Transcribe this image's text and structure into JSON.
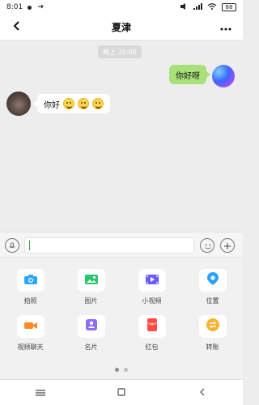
{
  "status_bar": {
    "time": "8:01",
    "battery": "88"
  },
  "header": {
    "title": "夏津"
  },
  "chat": {
    "time_badge": "晚上 20:00",
    "messages": [
      {
        "side": "right",
        "text": "你好呀"
      },
      {
        "side": "left",
        "text": "你好"
      }
    ]
  },
  "input": {
    "value": ""
  },
  "panel": {
    "items": [
      {
        "label": "拍照",
        "icon": "camera-icon"
      },
      {
        "label": "图片",
        "icon": "image-icon"
      },
      {
        "label": "小视频",
        "icon": "video-icon"
      },
      {
        "label": "位置",
        "icon": "location-icon"
      },
      {
        "label": "视频聊天",
        "icon": "video-call-icon"
      },
      {
        "label": "名片",
        "icon": "contact-card-icon"
      },
      {
        "label": "红包",
        "icon": "red-packet-icon"
      },
      {
        "label": "转账",
        "icon": "transfer-icon"
      }
    ],
    "colors": {
      "camera": "#2ba6ff",
      "image": "#29c66b",
      "video": "#6b5cff",
      "location": "#2aa1ff",
      "video_call": "#ff8a2a",
      "card": "#8e6bff",
      "red_packet": "#ff4b4b",
      "transfer": "#ffb12a"
    }
  }
}
